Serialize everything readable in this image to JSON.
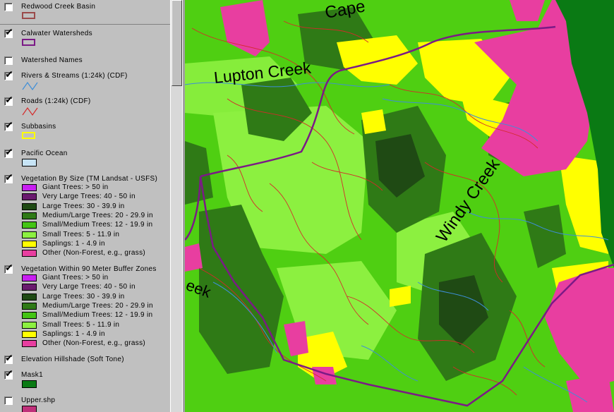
{
  "legend": {
    "layers": [
      {
        "name": "Redwood Creek Basin",
        "checked": false,
        "symbol": "box",
        "color": "#9b4b4b"
      },
      {
        "name": "Calwater Watersheds",
        "checked": true,
        "symbol": "box",
        "color": "#7b1a86"
      },
      {
        "name": "Watershed Names",
        "checked": false,
        "symbol": "none",
        "color": ""
      },
      {
        "name": "Rivers & Streams (1:24k) (CDF)",
        "checked": true,
        "symbol": "line",
        "color": "#3e8ed8"
      },
      {
        "name": "Roads (1:24k) (CDF)",
        "checked": true,
        "symbol": "line",
        "color": "#d42a2a"
      },
      {
        "name": "Subbasins",
        "checked": true,
        "symbol": "box",
        "color": "#ffff00"
      },
      {
        "name": "Pacific Ocean",
        "checked": true,
        "symbol": "fill",
        "color": "#c7e4f6"
      }
    ],
    "veg_size": {
      "name": "Vegetation By Size (TM Landsat - USFS)",
      "checked": true,
      "classes": [
        {
          "label": "Giant Trees: > 50 in",
          "color": "#c81ef0"
        },
        {
          "label": "Very Large Trees: 40 - 50 in",
          "color": "#6a1a6e"
        },
        {
          "label": "Large Trees: 30 - 39.9 in",
          "color": "#1f4a14"
        },
        {
          "label": "Medium/Large Trees: 20 - 29.9 in",
          "color": "#2f7a16"
        },
        {
          "label": "Small/Medium Trees: 12 - 19.9 in",
          "color": "#44c414"
        },
        {
          "label": "Small Trees: 5 - 11.9 in",
          "color": "#8cf040"
        },
        {
          "label": "Saplings: 1 - 4.9 in",
          "color": "#ffff00"
        },
        {
          "label": "Other (Non-Forest, e.g., grass)",
          "color": "#e83ea0"
        }
      ]
    },
    "veg_buffer": {
      "name": "Vegetation Within 90 Meter Buffer Zones",
      "checked": true,
      "classes": [
        {
          "label": "Giant Trees: > 50 in",
          "color": "#c81ef0"
        },
        {
          "label": "Very Large Trees: 40 - 50 in",
          "color": "#6a1a6e"
        },
        {
          "label": "Large Trees: 30 - 39.9 in",
          "color": "#1f4a14"
        },
        {
          "label": "Medium/Large Trees: 20 - 29.9 in",
          "color": "#2f7a16"
        },
        {
          "label": "Small/Medium Trees: 12 - 19.9 in",
          "color": "#44c414"
        },
        {
          "label": "Small Trees: 5 - 11.9 in",
          "color": "#8cf040"
        },
        {
          "label": "Saplings: 1 - 4.9 in",
          "color": "#ffff00"
        },
        {
          "label": "Other (Non-Forest, e.g., grass)",
          "color": "#e83ea0"
        }
      ]
    },
    "tail_layers": [
      {
        "name": "Elevation Hillshade (Soft Tone)",
        "checked": true,
        "symbol": "none",
        "color": ""
      },
      {
        "name": "Mask1",
        "checked": true,
        "symbol": "fill",
        "color": "#0a7a14"
      },
      {
        "name": "Upper.shp",
        "checked": false,
        "symbol": "fill",
        "color": "#c0307a"
      }
    ]
  },
  "map": {
    "labels": {
      "lupton": "Lupton Creek",
      "windy": "Windy Creek",
      "cape": "Cape",
      "eek": "eek"
    },
    "colors": {
      "ocean_mask": "#0a7a14",
      "watershed": "#7b1a86",
      "rivers": "#3e8ed8",
      "roads": "#d42a2a"
    }
  }
}
